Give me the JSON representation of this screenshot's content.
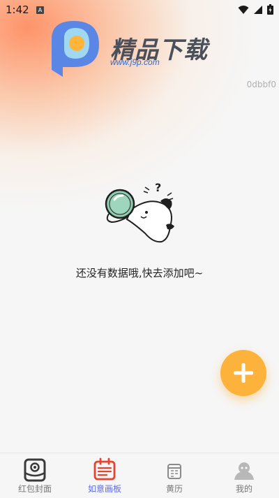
{
  "status_bar": {
    "time": "1:42",
    "notification_letter": "A"
  },
  "header": {
    "logo_title": "精品下载",
    "logo_url": "www.j9p.com",
    "version_code": "0dbbf0"
  },
  "main": {
    "empty_message": "还没有数据哦,快去添加吧~"
  },
  "fab": {
    "icon": "plus-icon",
    "color": "#fdb23c"
  },
  "tabbar": {
    "active_color": "#5a6cf0",
    "items": [
      {
        "label": "红包封面",
        "icon": "red-envelope-icon"
      },
      {
        "label": "如意画板",
        "icon": "calendar-board-icon"
      },
      {
        "label": "黄历",
        "icon": "almanac-icon"
      },
      {
        "label": "我的",
        "icon": "profile-icon"
      }
    ]
  }
}
